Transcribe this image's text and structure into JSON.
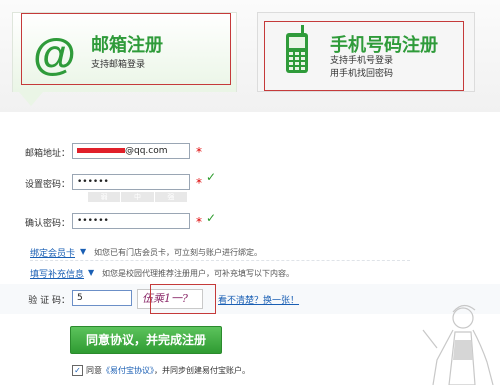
{
  "tabs": {
    "email": {
      "title": "邮箱注册",
      "subtitle": "支持邮箱登录"
    },
    "phone": {
      "title": "手机号码注册",
      "subtitle_1": "支持手机号登录",
      "subtitle_2": "用手机找回密码"
    }
  },
  "form": {
    "email_label": "邮箱地址：",
    "email_value": "@qq.com",
    "password_label": "设置密码：",
    "password_value": "••••••",
    "strength_levels": [
      "弱",
      "中",
      "强"
    ],
    "confirm_label": "确认密码：",
    "confirm_value": "••••••",
    "required_mark": "*",
    "valid_mark": "✓"
  },
  "optional": {
    "member_link": "绑定会员卡",
    "member_desc": "如您已有门店会员卡，可立刻与账户进行绑定。",
    "extra_link": "填写补充信息",
    "extra_desc": "如您是校园代理推荐注册用户，可补充填写以下内容。"
  },
  "captcha": {
    "label": "验 证 码：",
    "value": "5",
    "image_text": "伍乘1一?",
    "refresh_text": "看不清楚？换一张！"
  },
  "submit_label": "同意协议，并完成注册",
  "agreement": {
    "prefix": "同意",
    "link": "《易付宝协议》",
    "suffix": "，并同步创建易付宝账户。"
  }
}
